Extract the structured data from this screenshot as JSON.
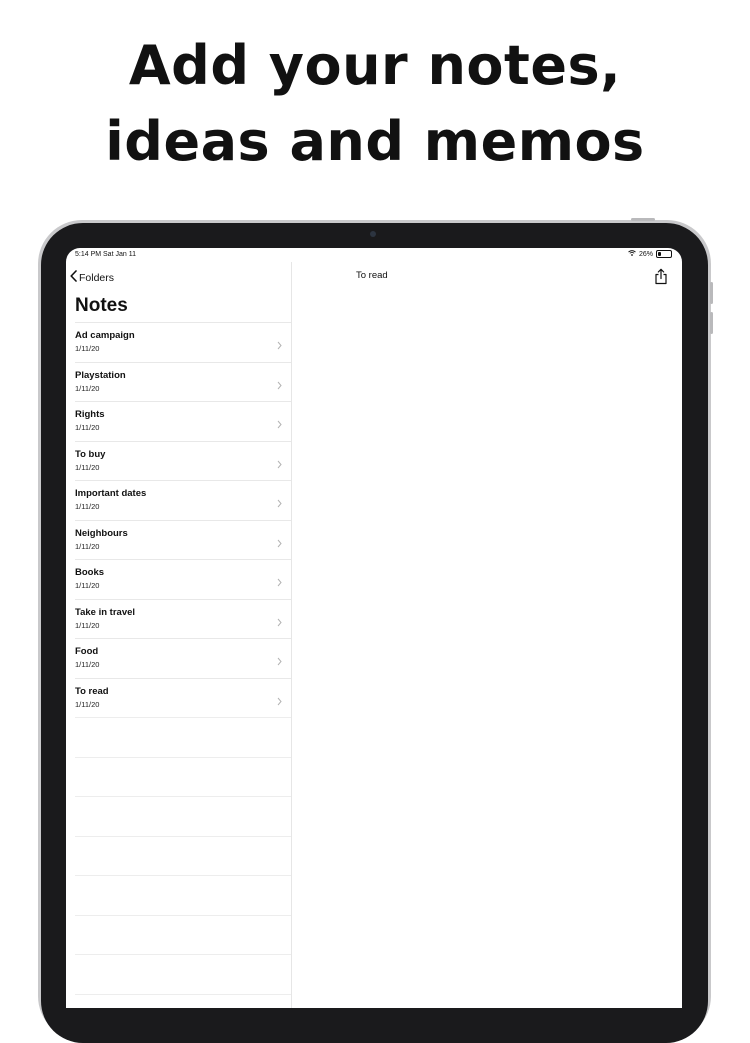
{
  "headline": {
    "line1": "Add your notes,",
    "line2": "ideas and memos"
  },
  "status_bar": {
    "time": "5:14 PM  Sat Jan 11",
    "battery": "26%",
    "battery_level": 0.26,
    "wifi_icon": "wifi-icon",
    "battery_icon": "battery-icon"
  },
  "sidebar": {
    "back_label": "Folders",
    "back_icon": "chevron-left-icon",
    "title": "Notes",
    "notes": [
      {
        "title": "Ad campaign",
        "date": "1/11/20"
      },
      {
        "title": "Playstation",
        "date": "1/11/20"
      },
      {
        "title": "Rights",
        "date": "1/11/20"
      },
      {
        "title": "To buy",
        "date": "1/11/20"
      },
      {
        "title": "Important dates",
        "date": "1/11/20"
      },
      {
        "title": "Neighbours",
        "date": "1/11/20"
      },
      {
        "title": "Books",
        "date": "1/11/20"
      },
      {
        "title": "Take in travel",
        "date": "1/11/20"
      },
      {
        "title": "Food",
        "date": "1/11/20"
      },
      {
        "title": "To read",
        "date": "1/11/20"
      }
    ]
  },
  "detail": {
    "title": "To read",
    "share_icon": "share-icon"
  }
}
